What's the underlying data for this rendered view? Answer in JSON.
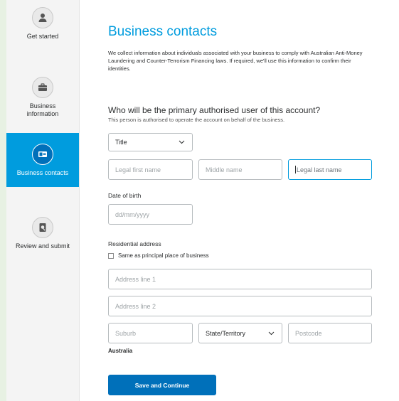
{
  "sidebar": {
    "steps": [
      {
        "label": "Get started",
        "icon": "person-icon",
        "active": false
      },
      {
        "label": "Business information",
        "icon": "briefcase-icon",
        "active": false
      },
      {
        "label": "Business contacts",
        "icon": "id-card-icon",
        "active": true
      },
      {
        "label": "Review and submit",
        "icon": "review-icon",
        "active": false
      }
    ]
  },
  "main": {
    "title": "Business contacts",
    "intro": "We collect information about individuals associated with your business to comply with Australian Anti-Money Laundering and Counter-Terrorism Financing laws. If required, we'll use this information to confirm their identities.",
    "question": "Who will be the primary authorised user of this account?",
    "question_sub": "This person is authorised to operate the account on behalf of the business.",
    "title_select": "Title",
    "first_name_placeholder": "Legal first name",
    "middle_name_placeholder": "Middle name",
    "last_name_placeholder": "Legal last name",
    "dob_label": "Date of birth",
    "dob_placeholder": "dd/mm/yyyy",
    "address_label": "Residential address",
    "same_as_label": "Same as principal place of business",
    "address1_placeholder": "Address line 1",
    "address2_placeholder": "Address line 2",
    "suburb_placeholder": "Suburb",
    "state_select": "State/Territory",
    "postcode_placeholder": "Postcode",
    "country": "Australia",
    "save_label": "Save and Continue"
  },
  "colors": {
    "accent": "#009cde",
    "button": "#0070ba",
    "background": "#e7f1e3"
  }
}
